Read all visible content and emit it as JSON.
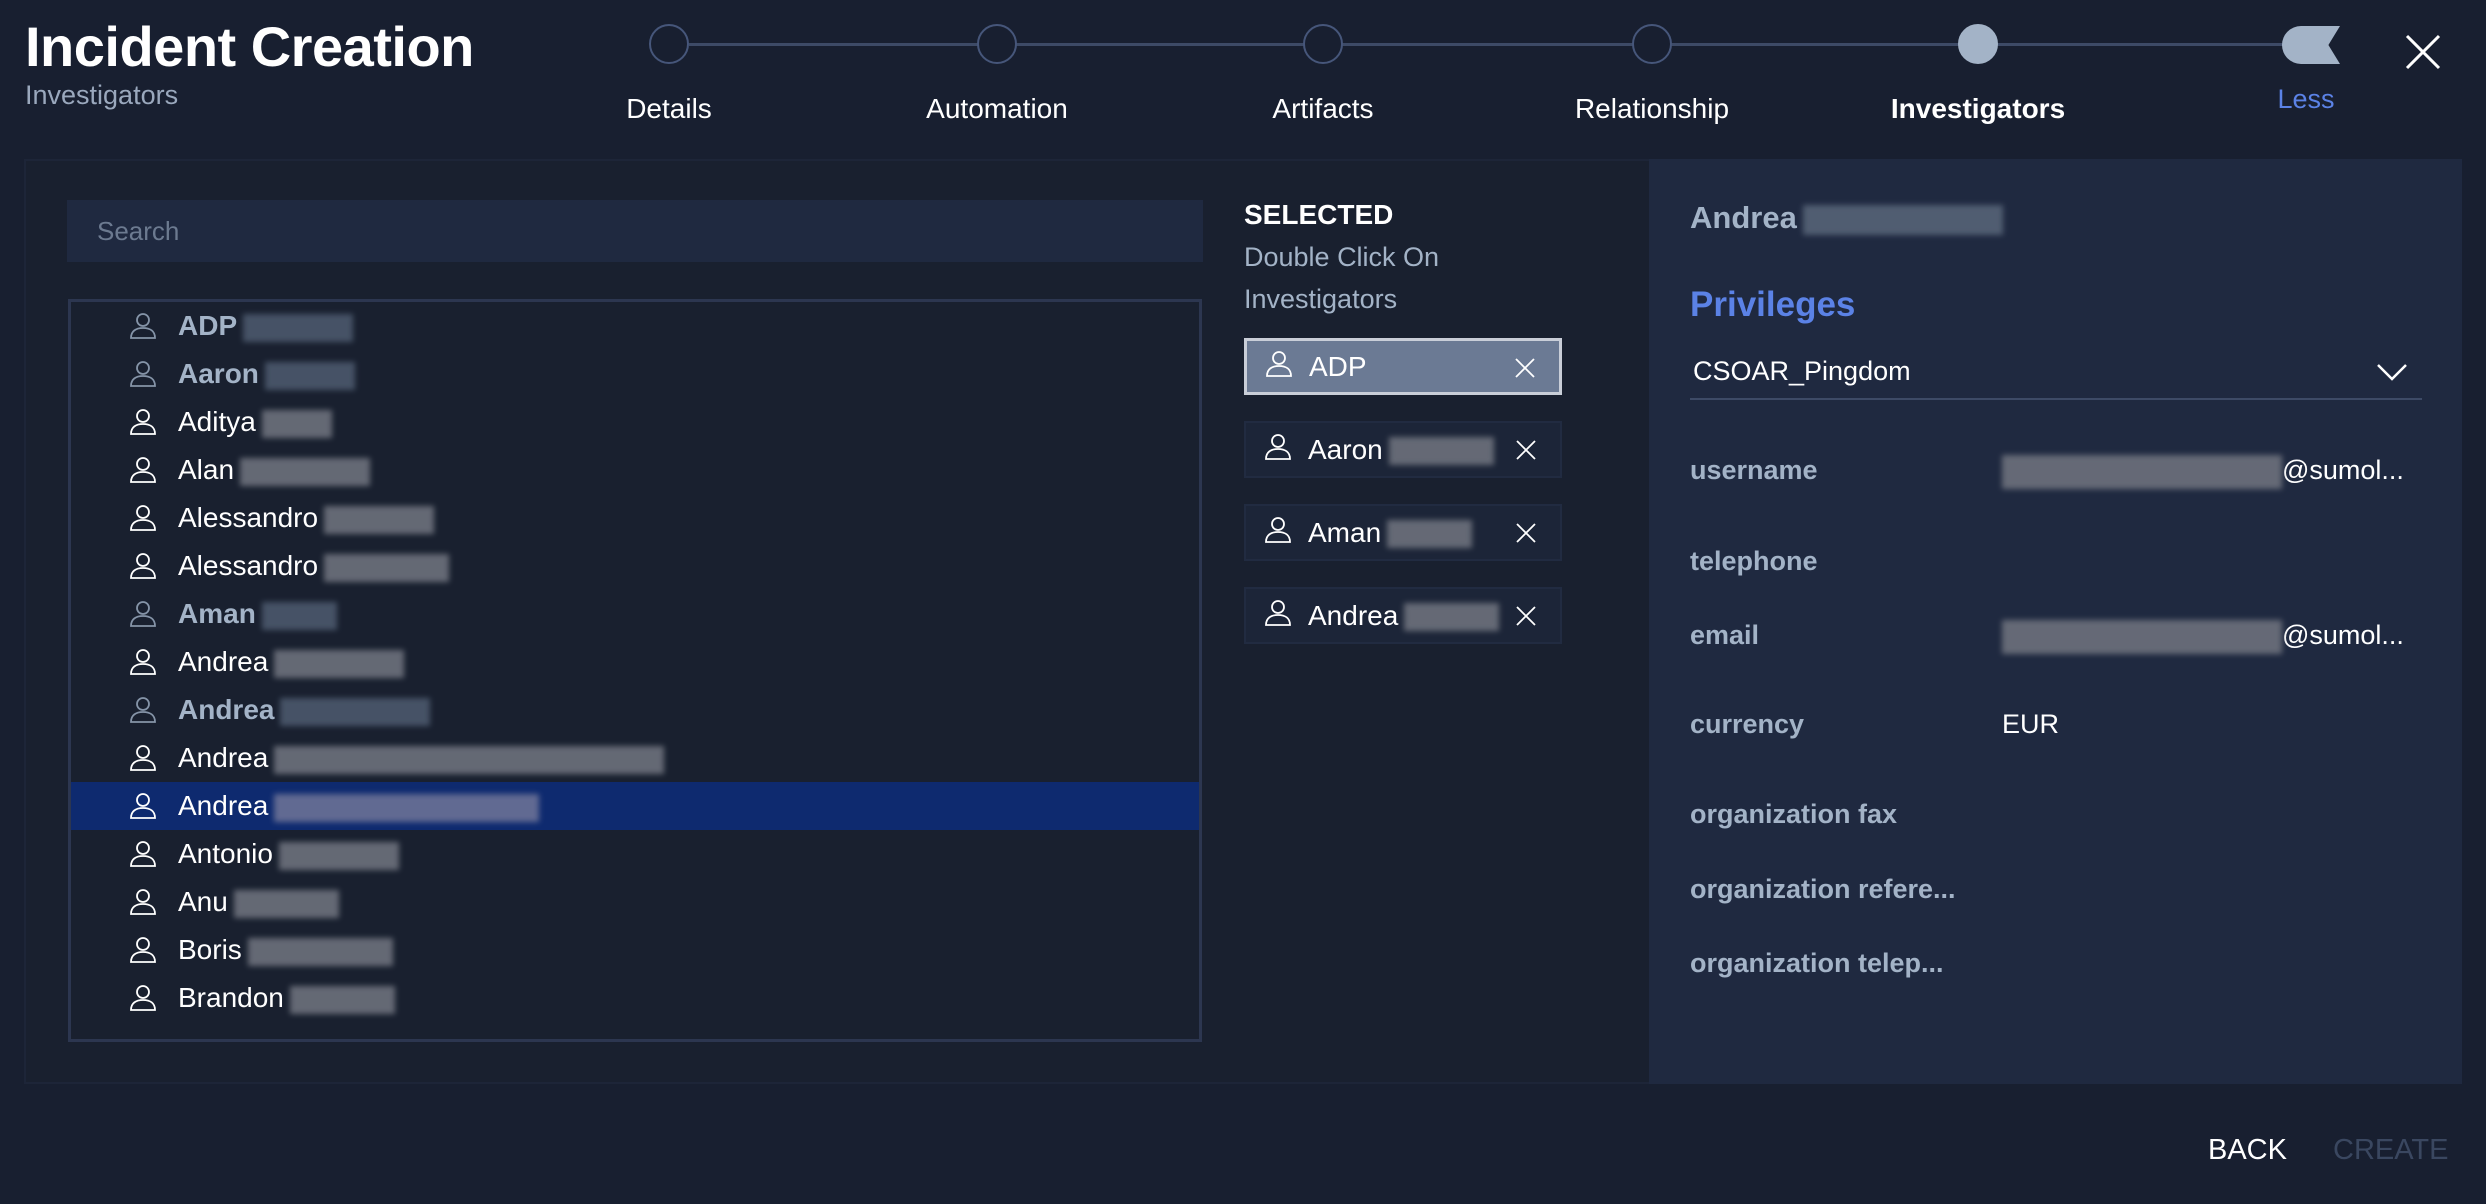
{
  "header": {
    "title": "Incident Creation",
    "subtitle": "Investigators",
    "less_label": "Less"
  },
  "steps": [
    {
      "label": "Details",
      "state": "todo"
    },
    {
      "label": "Automation",
      "state": "todo"
    },
    {
      "label": "Artifacts",
      "state": "todo"
    },
    {
      "label": "Relationship",
      "state": "todo"
    },
    {
      "label": "Investigators",
      "state": "active"
    }
  ],
  "search": {
    "placeholder": "Search",
    "value": ""
  },
  "list": [
    {
      "name": "ADP",
      "dim": true
    },
    {
      "name": "Aaron",
      "dim": true
    },
    {
      "name": "Aditya"
    },
    {
      "name": "Alan"
    },
    {
      "name": "Alessandro"
    },
    {
      "name": "Alessandro"
    },
    {
      "name": "Aman",
      "dim": true
    },
    {
      "name": "Andrea"
    },
    {
      "name": "Andrea",
      "dim": true
    },
    {
      "name": "Andrea"
    },
    {
      "name": "Andrea",
      "selected": true
    },
    {
      "name": "Antonio"
    },
    {
      "name": "Anu"
    },
    {
      "name": "Boris"
    },
    {
      "name": "Brandon"
    }
  ],
  "selected": {
    "heading": "SELECTED",
    "hint": "Double Click On Investigators",
    "items": [
      "ADP",
      "Aaron",
      "Aman",
      "Andrea"
    ]
  },
  "details": {
    "name": "Andrea",
    "privileges_heading": "Privileges",
    "privilege_value": "CSOAR_Pingdom",
    "fields": [
      {
        "label": "username",
        "value": "@sumol...",
        "blurred": true
      },
      {
        "label": "telephone",
        "value": ""
      },
      {
        "label": "email",
        "value": "@sumol...",
        "blurred": true
      },
      {
        "label": "currency",
        "value": "EUR"
      },
      {
        "label": "organization fax",
        "value": ""
      },
      {
        "label": "organization refere...",
        "value": ""
      },
      {
        "label": "organization telep...",
        "value": ""
      }
    ]
  },
  "footer": {
    "back": "BACK",
    "create": "CREATE"
  },
  "colors": {
    "background": "#181f30",
    "panel": "#1f2940",
    "accent": "#5b82e6",
    "selected_row": "#0e2a6f"
  }
}
